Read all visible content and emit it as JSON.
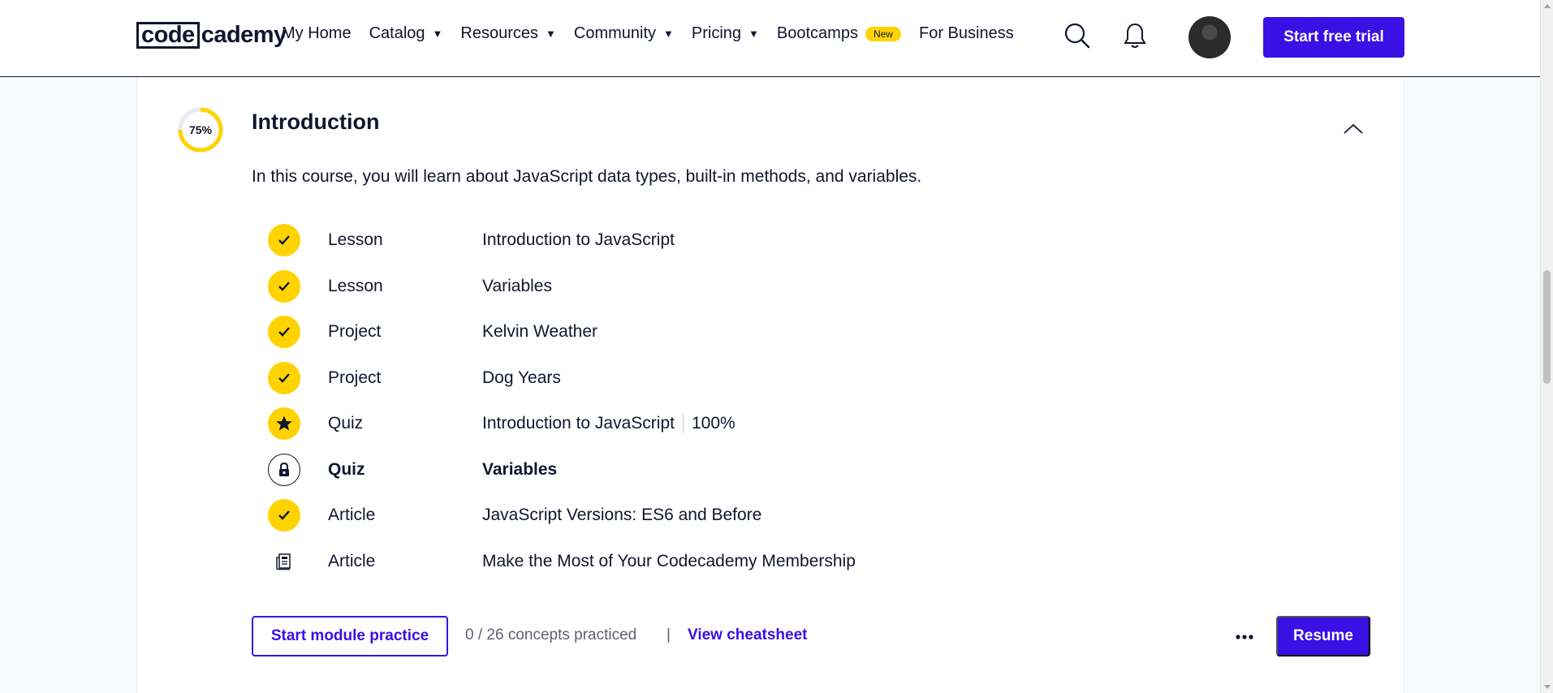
{
  "header": {
    "logo_code": "code",
    "logo_rest": "cademy",
    "nav": [
      {
        "label": "My Home",
        "caret": false
      },
      {
        "label": "Catalog",
        "caret": true
      },
      {
        "label": "Resources",
        "caret": true
      },
      {
        "label": "Community",
        "caret": true
      },
      {
        "label": "Pricing",
        "caret": true
      },
      {
        "label": "Bootcamps",
        "caret": false,
        "badge": "New"
      },
      {
        "label": "For Business",
        "caret": false
      }
    ],
    "search_icon": "search-icon",
    "bell_icon": "bell-icon",
    "trial_label": "Start free trial"
  },
  "module": {
    "progress_label": "75%",
    "progress": 0.75,
    "title": "Introduction",
    "description": "In this course, you will learn about JavaScript data types, built-in methods, and variables.",
    "items": [
      {
        "status": "done",
        "type": "Lesson",
        "name": "Introduction to JavaScript"
      },
      {
        "status": "done",
        "type": "Lesson",
        "name": "Variables"
      },
      {
        "status": "done",
        "type": "Project",
        "name": "Kelvin Weather"
      },
      {
        "status": "done",
        "type": "Project",
        "name": "Dog Years"
      },
      {
        "status": "star",
        "type": "Quiz",
        "name": "Introduction to JavaScript",
        "score": "100%"
      },
      {
        "status": "locked",
        "type": "Quiz",
        "name": "Variables",
        "bold": true
      },
      {
        "status": "done",
        "type": "Article",
        "name": "JavaScript Versions: ES6 and Before"
      },
      {
        "status": "article",
        "type": "Article",
        "name": "Make the Most of Your Codecademy Membership"
      }
    ],
    "practice_label": "Start module practice",
    "concepts_text": "0 / 26 concepts practiced",
    "separator": "|",
    "cheatsheet_label": "View cheatsheet",
    "resume_label": "Resume"
  },
  "colors": {
    "brand": "#3a10e5",
    "yellow": "#ffd300",
    "navy": "#10162f"
  }
}
